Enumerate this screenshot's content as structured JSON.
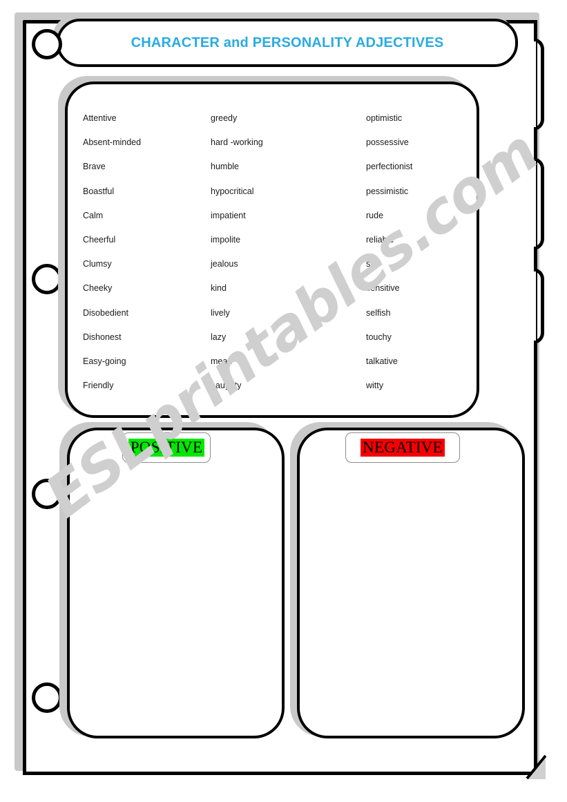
{
  "worksheet": {
    "title": "CHARACTER and PERSONALITY ADJECTIVES",
    "title_color": "#29ABE2",
    "watermark": "ESLprintables.com"
  },
  "word_list": {
    "rows": [
      {
        "col1": "Attentive",
        "col2": "greedy",
        "col3": "optimistic"
      },
      {
        "col1": "Absent-minded",
        "col2": "hard -working",
        "col3": "possessive"
      },
      {
        "col1": "Brave",
        "col2": "humble",
        "col3": "perfectionist"
      },
      {
        "col1": "Boastful",
        "col2": "hypocritical",
        "col3": "pessimistic"
      },
      {
        "col1": "Calm",
        "col2": "impatient",
        "col3": "rude"
      },
      {
        "col1": "Cheerful",
        "col2": "impolite",
        "col3": "reliable"
      },
      {
        "col1": "Clumsy",
        "col2": "jealous",
        "col3": "shy"
      },
      {
        "col1": "Cheeky",
        "col2": "kind",
        "col3": "sensitive"
      },
      {
        "col1": "Disobedient",
        "col2": "lively",
        "col3": "selfish"
      },
      {
        "col1": "Dishonest",
        "col2": "lazy",
        "col3": "touchy"
      },
      {
        "col1": "Easy-going",
        "col2": "mean",
        "col3": "talkative"
      },
      {
        "col1": "Friendly",
        "col2": "naughty",
        "col3": "witty"
      }
    ]
  },
  "sort_boxes": {
    "positive": {
      "label": "POSITIVE",
      "highlight_color": "#00e800",
      "content": ""
    },
    "negative": {
      "label": "NEGATIVE",
      "highlight_color": "#f50000",
      "content": ""
    }
  }
}
